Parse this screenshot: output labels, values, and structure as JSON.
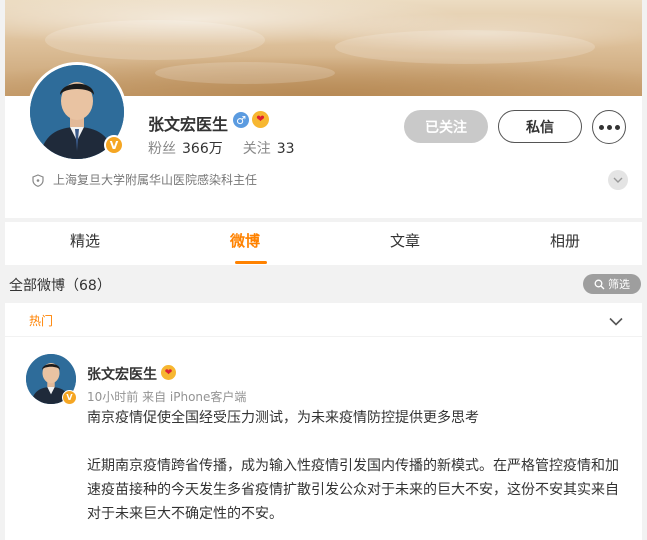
{
  "profile": {
    "name": "张文宏医生",
    "gender_icon": "♂",
    "badge_glyph": "V",
    "emoji_glyph": "❤",
    "followers_label": "粉丝",
    "followers_value": "366万",
    "following_label": "关注",
    "following_value": "33",
    "bio": "上海复旦大学附属华山医院感染科主任"
  },
  "actions": {
    "followed_label": "已关注",
    "message_label": "私信"
  },
  "tabs": [
    {
      "label": "精选",
      "active": false
    },
    {
      "label": "微博",
      "active": true
    },
    {
      "label": "文章",
      "active": false
    },
    {
      "label": "相册",
      "active": false
    }
  ],
  "feed": {
    "title": "全部微博（68）",
    "filter_label": "筛选",
    "hot_label": "热门"
  },
  "post": {
    "author": "张文宏医生",
    "meta": "10小时前  来自 iPhone客户端",
    "paragraph1": "南京疫情促使全国经受压力测试，为未来疫情防控提供更多思考",
    "paragraph2_line1": "近期南京疫情跨省传播，成为输入性疫情引发国内传播的新模式。在严格管控疫情和加",
    "paragraph2_line2": "速疫苗接种的今天发生多省疫情扩散引发公众对于未来的巨大不安，这份不安其实来自",
    "paragraph2_line3": "对于未来巨大不确定性的不安。"
  },
  "colors": {
    "accent": "#ff8200",
    "badge": "#f5a623",
    "gender": "#5b9be0"
  }
}
